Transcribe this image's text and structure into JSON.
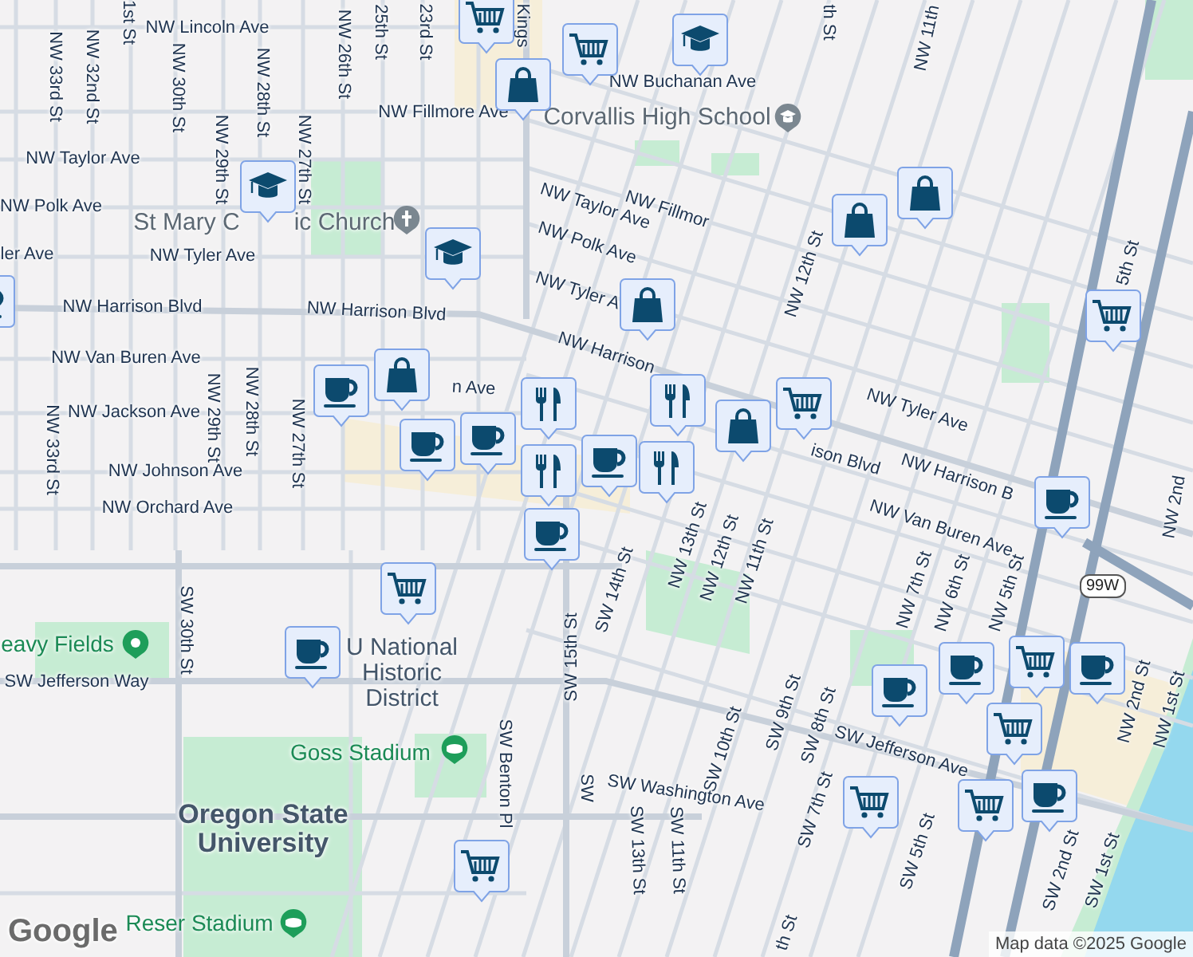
{
  "map": {
    "street_labels": [
      "1st St",
      "NW Lincoln Ave",
      "25th St",
      "23rd St",
      "Kings",
      "NW 33rd St",
      "NW 32nd St",
      "NW 30th St",
      "NW 28th St",
      "NW 26th St",
      "NW Fillmore Ave",
      "NW 29th St",
      "NW 27th St",
      "NW Taylor Ave",
      "NW Polk Ave",
      "ler Ave",
      "NW Tyler Ave",
      "NW Harrison Blvd",
      "NW Harrison Blvd",
      "NW Van Buren Ave",
      "n Ave",
      "NW Jackson Ave",
      "NW 29th St",
      "NW 28th St",
      "NW 27th St",
      "NW 33rd St",
      "NW Johnson Ave",
      "NW Orchard Ave",
      "th St",
      "NW 11th",
      "NW Buchanan Ave",
      "NW Taylor Ave",
      "NW Polk Ave",
      "NW Tyler A",
      "NW Harrison",
      "NW Fillmor",
      "NW 12th St",
      "5th St",
      "ison Blvd",
      "NW Tyler Ave",
      "NW Harrison B",
      "NW Van Buren Ave",
      "NW 13th St",
      "NW 12th St",
      "NW 11th St",
      "SW 14th St",
      "NW 7th St",
      "NW 6th St",
      "NW 5th St",
      "NW 2nd",
      "NW 2nd St",
      "NW 1st St",
      "SW 15th St",
      "SW 30th St",
      "SW Jefferson Way",
      "SW 9th St",
      "SW 8th St",
      "SW 10th St",
      "SW Jefferson Ave",
      "SW Benton Pl",
      "SW",
      "SW Washington Ave",
      "SW 13th St",
      "SW 11th St",
      "SW 7th St",
      "SW 5th St",
      "SW 2nd St",
      "SW 1st St",
      "th St"
    ],
    "places": [
      {
        "kind": "school",
        "lines": [
          "Corvallis High School"
        ]
      },
      {
        "kind": "church",
        "lines": [
          "St Mary C"
        ]
      },
      {
        "kind": "church",
        "lines": [
          "ic Church"
        ]
      },
      {
        "kind": "park",
        "lines": [
          "eavy Fields"
        ]
      },
      {
        "kind": "district",
        "lines": [
          "U National",
          "Historic",
          "District"
        ]
      },
      {
        "kind": "stadium",
        "lines": [
          "Goss Stadium"
        ]
      },
      {
        "kind": "campus",
        "lines": [
          "Oregon State",
          "University"
        ]
      },
      {
        "kind": "stadium",
        "lines": [
          "Reser Stadium"
        ]
      }
    ],
    "route_shield": "99W",
    "markers": [
      {
        "kind": "grocery"
      },
      {
        "kind": "grocery"
      },
      {
        "kind": "shopping"
      },
      {
        "kind": "school"
      },
      {
        "kind": "school"
      },
      {
        "kind": "school"
      },
      {
        "kind": "cafe"
      },
      {
        "kind": "shopping"
      },
      {
        "kind": "shopping"
      },
      {
        "kind": "shopping"
      },
      {
        "kind": "grocery"
      },
      {
        "kind": "shopping"
      },
      {
        "kind": "cafe"
      },
      {
        "kind": "cafe"
      },
      {
        "kind": "restaurant"
      },
      {
        "kind": "cafe"
      },
      {
        "kind": "restaurant"
      },
      {
        "kind": "cafe"
      },
      {
        "kind": "cafe"
      },
      {
        "kind": "restaurant"
      },
      {
        "kind": "restaurant"
      },
      {
        "kind": "grocery"
      },
      {
        "kind": "shopping"
      },
      {
        "kind": "cafe"
      },
      {
        "kind": "grocery"
      },
      {
        "kind": "cafe"
      },
      {
        "kind": "grocery"
      },
      {
        "kind": "cafe"
      },
      {
        "kind": "cafe"
      },
      {
        "kind": "cafe"
      },
      {
        "kind": "grocery"
      },
      {
        "kind": "cafe"
      },
      {
        "kind": "grocery"
      },
      {
        "kind": "grocery"
      },
      {
        "kind": "grocery"
      }
    ],
    "logo": "Google",
    "attribution": "Map data ©2025 Google"
  }
}
